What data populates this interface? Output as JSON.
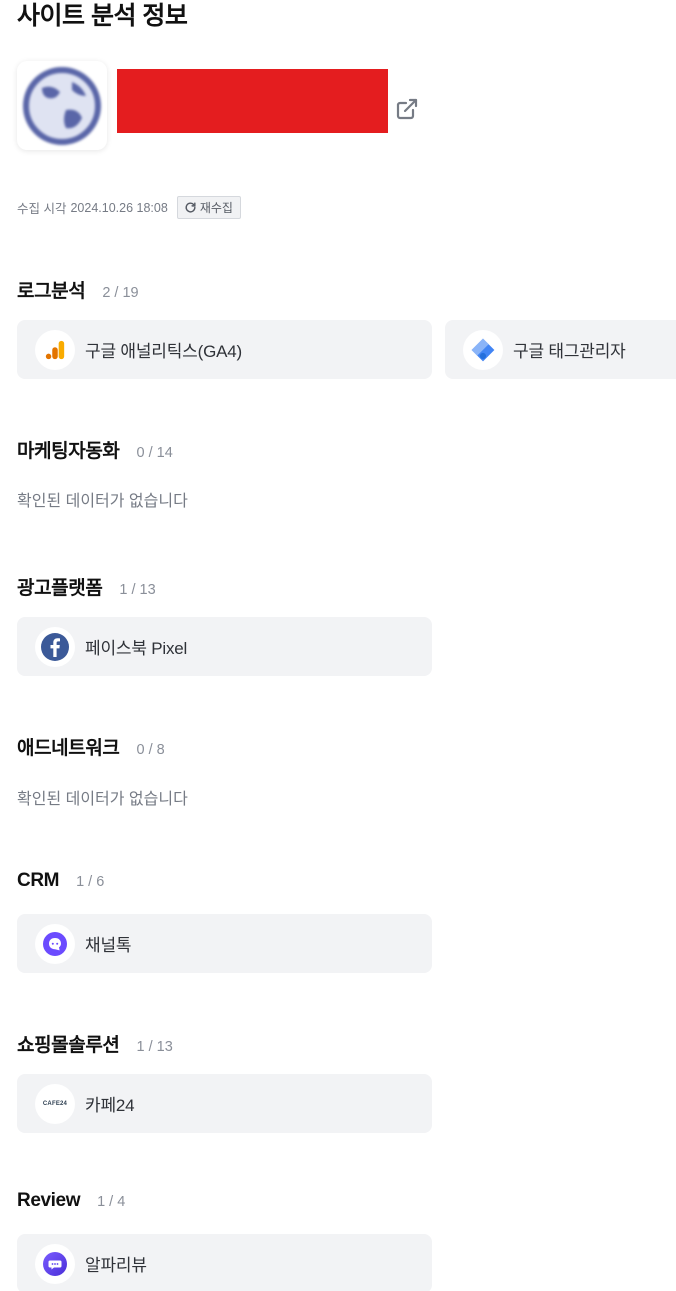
{
  "header": {
    "title": "사이트 분석 정보"
  },
  "collect": {
    "label": "수집 시각",
    "time": "2024.10.26 18:08",
    "recollect_label": "재수집"
  },
  "sections": [
    {
      "title": "로그분석",
      "count": "2 / 19",
      "items": [
        {
          "label": "구글 애널리틱스(GA4)",
          "icon": "google-analytics-icon"
        },
        {
          "label": "구글 태그관리자",
          "icon": "google-tag-manager-icon"
        }
      ]
    },
    {
      "title": "마케팅자동화",
      "count": "0 / 14",
      "empty_text": "확인된 데이터가 없습니다"
    },
    {
      "title": "광고플랫폼",
      "count": "1 / 13",
      "items": [
        {
          "label": "페이스북 Pixel",
          "icon": "facebook-icon"
        }
      ]
    },
    {
      "title": "애드네트워크",
      "count": "0 / 8",
      "empty_text": "확인된 데이터가 없습니다"
    },
    {
      "title": "CRM",
      "count": "1 / 6",
      "items": [
        {
          "label": "채널톡",
          "icon": "channeltalk-icon"
        }
      ]
    },
    {
      "title": "쇼핑몰솔루션",
      "count": "1 / 13",
      "items": [
        {
          "label": "카페24",
          "icon": "cafe24-icon"
        }
      ]
    },
    {
      "title": "Review",
      "count": "1 / 4",
      "items": [
        {
          "label": "알파리뷰",
          "icon": "alpha-review-icon"
        }
      ]
    }
  ],
  "icons": {
    "cafe24_text": "CAFE24"
  },
  "colors": {
    "redaction": "#e41d1f",
    "card_bg": "#f2f3f5",
    "muted_text": "#767b85",
    "ga_orange": "#f9ab00",
    "gtm_blue": "#4285f4",
    "facebook_blue": "#3b5998",
    "channeltalk_purple": "#6b4bff"
  }
}
